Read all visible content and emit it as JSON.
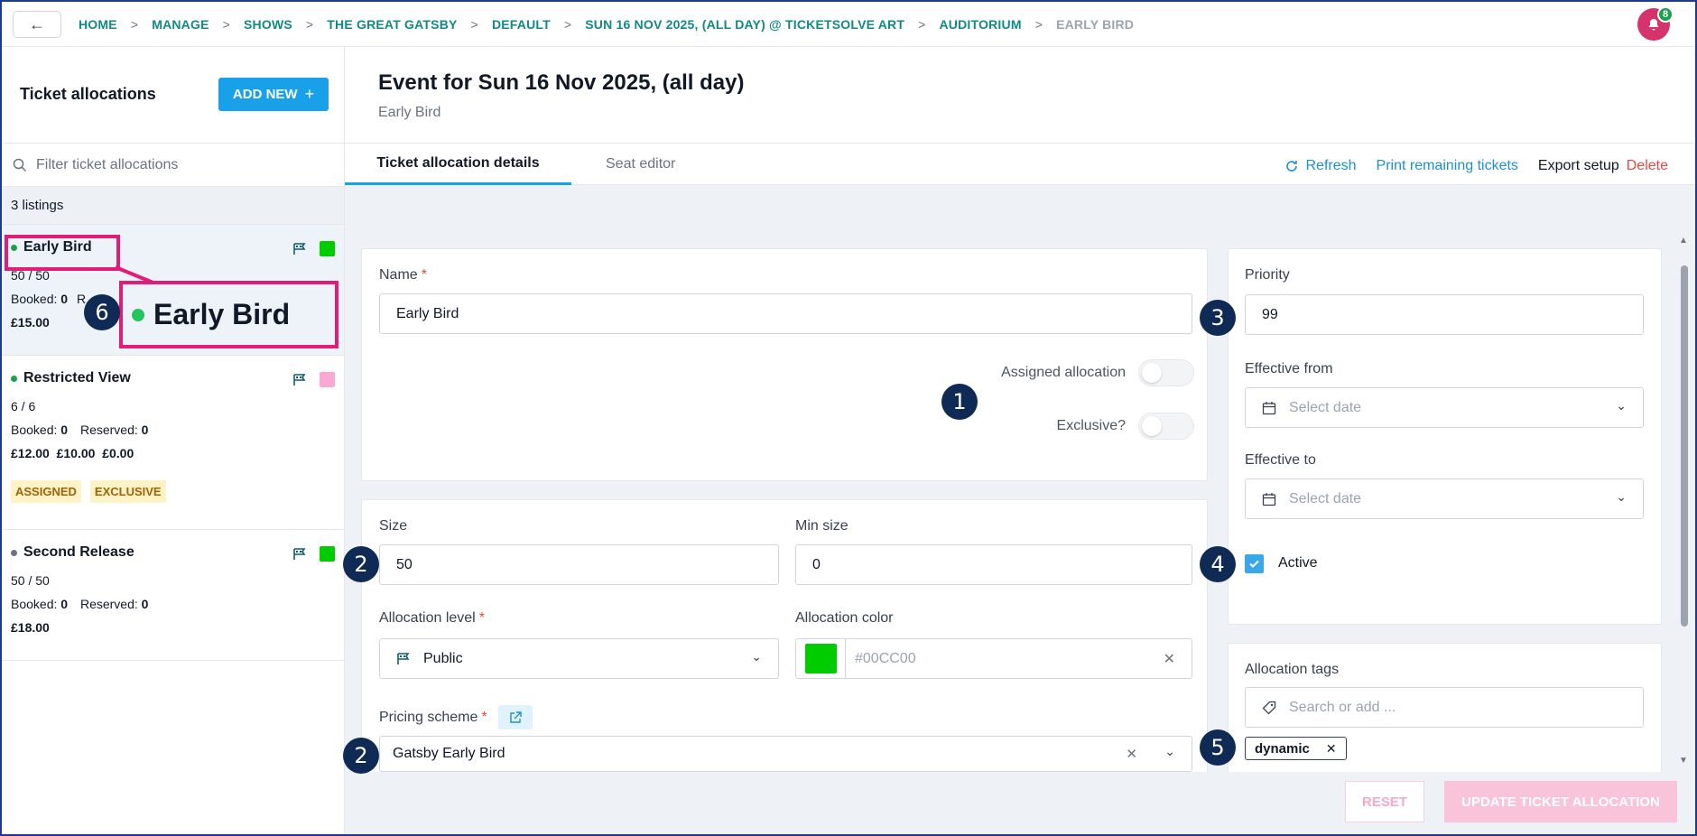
{
  "breadcrumb": [
    "HOME",
    "MANAGE",
    "SHOWS",
    "THE GREAT GATSBY",
    "DEFAULT",
    "SUN 16 NOV 2025, (ALL DAY) @ TICKETSOLVE ART",
    "AUDITORIUM",
    "EARLY BIRD"
  ],
  "breadcrumb_sep": ">",
  "notification_count": "8",
  "sidebar": {
    "title": "Ticket allocations",
    "add_new": "ADD NEW",
    "filter_placeholder": "Filter ticket allocations",
    "count": "3 listings",
    "listings": [
      {
        "name": "Early Bird",
        "dot_color": "#16a34a",
        "swatch": "#00CC00",
        "capacity": "50 / 50",
        "booked_label": "Booked:",
        "booked": "0",
        "reserved_partial": "R",
        "prices": "£15.00"
      },
      {
        "name": "Restricted View",
        "dot_color": "#16a34a",
        "swatch": "#f9a8d4",
        "capacity": "6 / 6",
        "booked_label": "Booked:",
        "booked": "0",
        "reserved_label": "Reserved:",
        "reserved": "0",
        "prices": "£12.00  £10.00  £0.00",
        "tags": [
          "ASSIGNED",
          "EXCLUSIVE"
        ]
      },
      {
        "name": "Second Release",
        "dot_color": "#6b7280",
        "swatch": "#00CC00",
        "capacity": "50 / 50",
        "booked_label": "Booked:",
        "booked": "0",
        "reserved_label": "Reserved:",
        "reserved": "0",
        "prices": "£18.00"
      }
    ]
  },
  "main": {
    "title": "Event for Sun 16 Nov 2025, (all day)",
    "subtitle": "Early Bird",
    "tabs": [
      "Ticket allocation details",
      "Seat editor"
    ],
    "actions": {
      "refresh": "Refresh",
      "print": "Print remaining tickets",
      "export": "Export setup",
      "delete": "Delete"
    }
  },
  "form": {
    "name_label": "Name",
    "name_value": "Early Bird",
    "assigned_label": "Assigned allocation",
    "exclusive_label": "Exclusive?",
    "size_label": "Size",
    "size_value": "50",
    "min_size_label": "Min size",
    "min_size_value": "0",
    "level_label": "Allocation level",
    "level_value": "Public",
    "color_label": "Allocation color",
    "color_value": "#00CC00",
    "pricing_label": "Pricing scheme",
    "pricing_value": "Gatsby Early Bird",
    "priority_label": "Priority",
    "priority_value": "99",
    "eff_from_label": "Effective from",
    "eff_to_label": "Effective to",
    "date_placeholder": "Select date",
    "active_label": "Active",
    "tags_label": "Allocation tags",
    "tags_placeholder": "Search or add ...",
    "tag_chip": "dynamic"
  },
  "footer": {
    "reset": "RESET",
    "update": "UPDATE TICKET ALLOCATION"
  },
  "markers": [
    "1",
    "2",
    "3",
    "4",
    "2",
    "5",
    "6"
  ],
  "zoom_label": "Early Bird"
}
